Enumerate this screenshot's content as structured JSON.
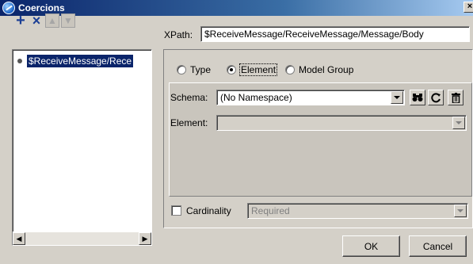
{
  "window": {
    "title": "Coercions",
    "close_glyph": "×"
  },
  "toolbar": {
    "add_icon": "plus-icon",
    "delete_icon": "delete-x-icon",
    "up_icon": "arrow-up-icon",
    "down_icon": "arrow-down-icon",
    "add_glyph": "+",
    "delete_glyph": "×",
    "up_glyph": "▲",
    "down_glyph": "▼"
  },
  "tree": {
    "items": [
      {
        "label": "$ReceiveMessage/Rece"
      }
    ]
  },
  "scroll": {
    "left_glyph": "◀",
    "right_glyph": "▶"
  },
  "xpath": {
    "label": "XPath:",
    "value": "$ReceiveMessage/ReceiveMessage/Message/Body"
  },
  "type_options": [
    {
      "label": "Type",
      "checked": false
    },
    {
      "label": "Element",
      "checked": true
    },
    {
      "label": "Model Group",
      "checked": false
    }
  ],
  "schema": {
    "label": "Schema:",
    "value": "(No Namespace)",
    "find_icon": "binoculars-icon",
    "refresh_icon": "refresh-icon",
    "delete_icon": "trash-icon"
  },
  "element": {
    "label": "Element:",
    "value": ""
  },
  "cardinality": {
    "label": "Cardinality",
    "checked": false,
    "value": "Required"
  },
  "buttons": {
    "ok": "OK",
    "cancel": "Cancel"
  },
  "colors": {
    "selection": "#0a246a",
    "face": "#d4d0c8"
  }
}
